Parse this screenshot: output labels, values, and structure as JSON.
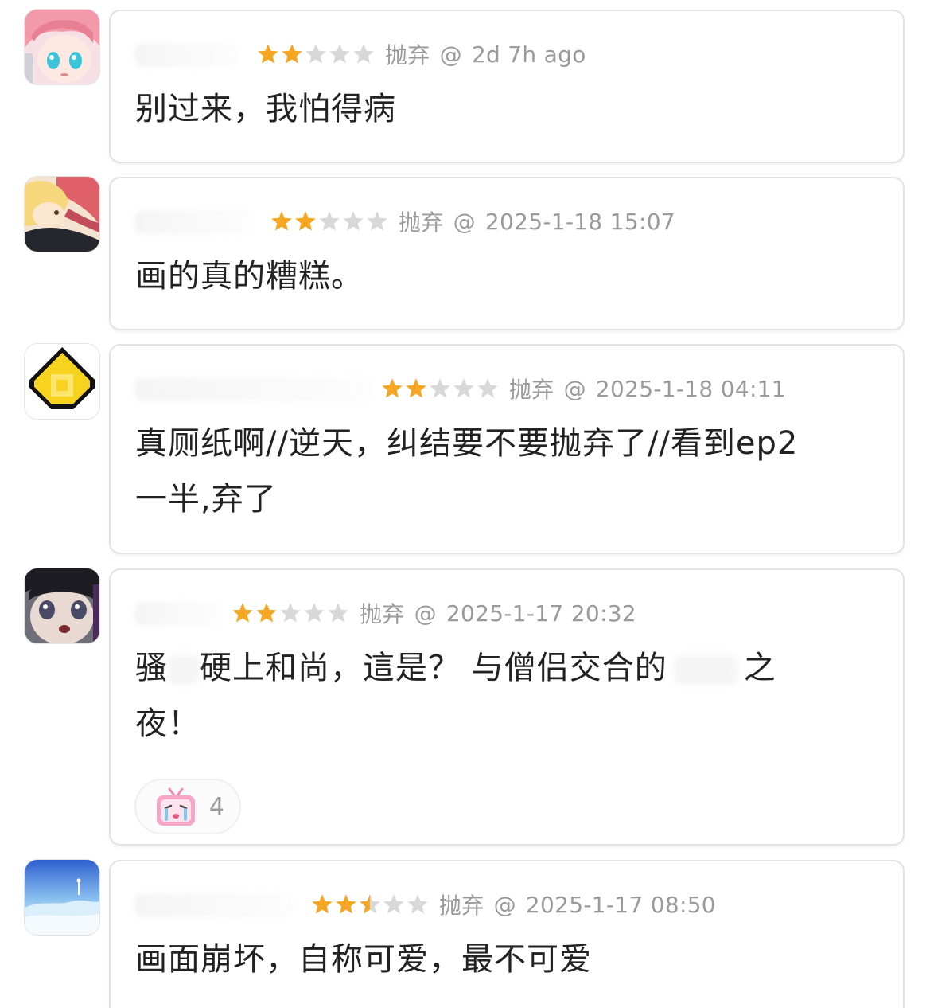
{
  "comments": [
    {
      "rating": 2,
      "status": "抛弃",
      "at": "@",
      "time": "2d 7h ago",
      "text": "别过来，我怕得病",
      "avatar_icon": "anime-pink-hair-avatar-icon"
    },
    {
      "rating": 2,
      "status": "抛弃",
      "at": "@",
      "time": "2025-1-18 15:07",
      "text": "画的真的糟糕。",
      "avatar_icon": "anime-blonde-avatar-icon"
    },
    {
      "rating": 2,
      "status": "抛弃",
      "at": "@",
      "time": "2025-1-18 04:11",
      "text_lines": [
        "真厕纸啊//逆天，纠结要不要抛弃了//看到ep2",
        "一半,弃了"
      ],
      "avatar_icon": "pixel-gold-coin-avatar-icon"
    },
    {
      "rating": 2,
      "status": "抛弃",
      "at": "@",
      "time": "2025-1-17 20:32",
      "text_parts": [
        "骚",
        "硬上和尚，這是？ 与僧侣交合的",
        "之"
      ],
      "text_line2": "夜！",
      "reaction": {
        "icon": "crying-tv-emoji-icon",
        "count": "4"
      },
      "avatar_icon": "anime-girl-crying-avatar-icon"
    },
    {
      "rating": 2.5,
      "status": "抛弃",
      "at": "@",
      "time": "2025-1-17 08:50",
      "text": "画面崩坏，自称可爱，最不可爱",
      "avatar_icon": "sky-landscape-avatar-icon"
    }
  ],
  "colors": {
    "star_filled": "#f5a623",
    "star_empty": "#d8d8d8",
    "meta_text": "#9a9a9a",
    "comment_text": "#222222",
    "card_border": "#e3e3e3"
  },
  "icons": {
    "star": "star-icon",
    "half_star": "half-star-icon"
  }
}
